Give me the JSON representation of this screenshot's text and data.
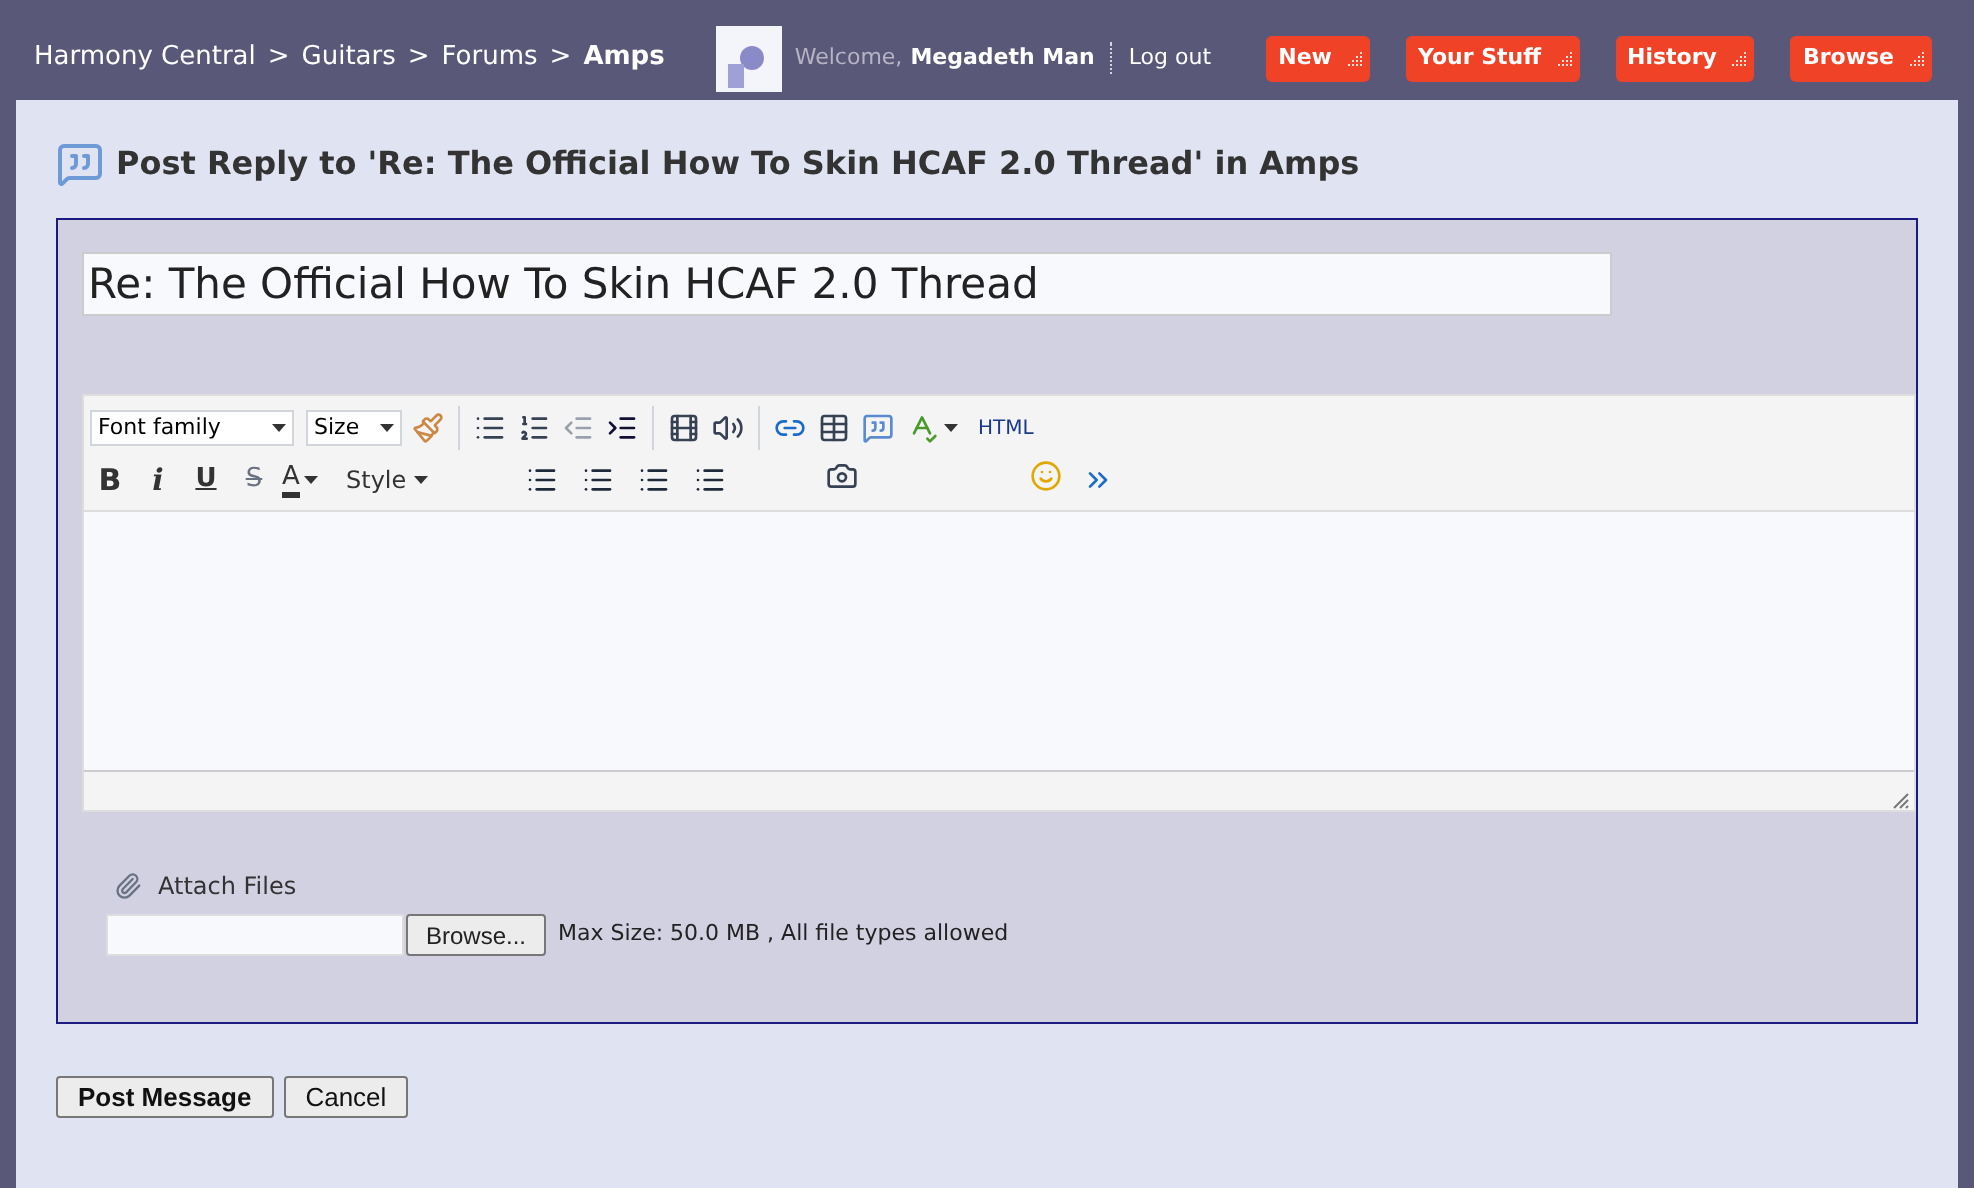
{
  "breadcrumb": [
    {
      "label": "Harmony Central",
      "current": false
    },
    {
      "label": ">",
      "current": false
    },
    {
      "label": "Guitars",
      "current": false
    },
    {
      "label": ">",
      "current": false
    },
    {
      "label": "Forums",
      "current": false
    },
    {
      "label": ">",
      "current": false
    },
    {
      "label": "Amps",
      "current": true
    }
  ],
  "user": {
    "greeting": "Welcome,",
    "name": "Megadeth Man",
    "logout": "Log out"
  },
  "nav_buttons": [
    "New",
    "Your Stuff",
    "History",
    "Browse"
  ],
  "page_title": "Post Reply to 'Re: The Official How To Skin HCAF 2.0 Thread' in Amps",
  "subject": {
    "value": "Re: The Official How To Skin HCAF 2.0 Thread"
  },
  "toolbar": {
    "font_family": "Font family",
    "size": "Size",
    "html": "HTML",
    "bold": "B",
    "italic": "i",
    "underline": "U",
    "strike": "S",
    "text_color_letter": "A",
    "style": "Style"
  },
  "attach": {
    "label": "Attach Files",
    "browse": "Browse...",
    "info": "Max Size: 50.0 MB , All file types allowed"
  },
  "actions": [
    "Post Message",
    "Cancel"
  ]
}
